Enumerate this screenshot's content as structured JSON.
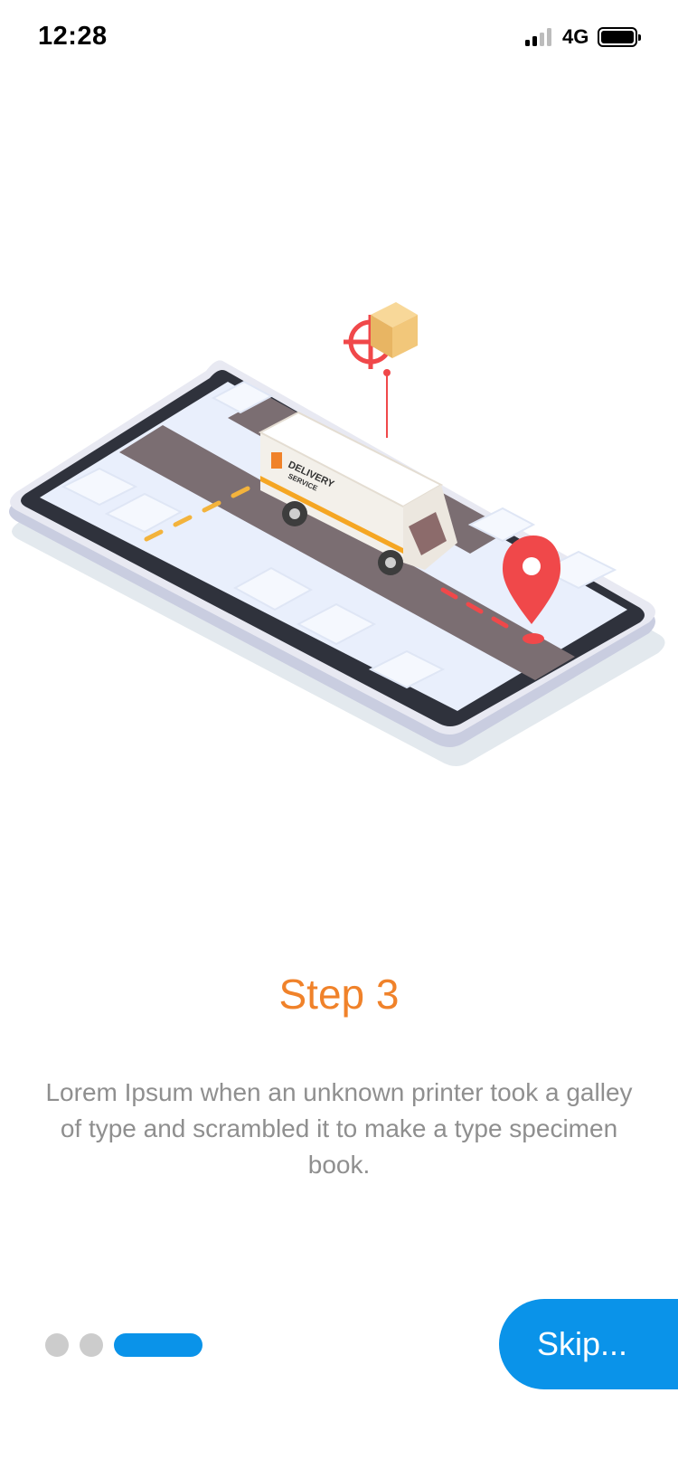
{
  "status_bar": {
    "time": "12:28",
    "network": "4G",
    "signal_bars": 4,
    "signal_active_bars": 2,
    "signal_icon": "signal-icon",
    "battery_icon": "battery-icon"
  },
  "onboarding": {
    "title": "Step 3",
    "description": "Lorem Ipsum when an unknown printer took a galley of type and scrambled it to make a type specimen book.",
    "skip_label": "Skip...",
    "page_count": 3,
    "current_page": 3
  },
  "illustration": {
    "van_brand": "DELIVERY",
    "van_subtitle": "SERVICE",
    "icons": [
      "phone-illustration",
      "delivery-van-icon",
      "location-pin-icon",
      "parcel-box-icon",
      "target-icon"
    ]
  },
  "colors": {
    "accent_orange": "#F0822A",
    "primary_blue": "#0A93E9",
    "dot_inactive": "#CCCCCC",
    "text_gray": "#8F8F8F",
    "pin_red": "#F0484A"
  }
}
